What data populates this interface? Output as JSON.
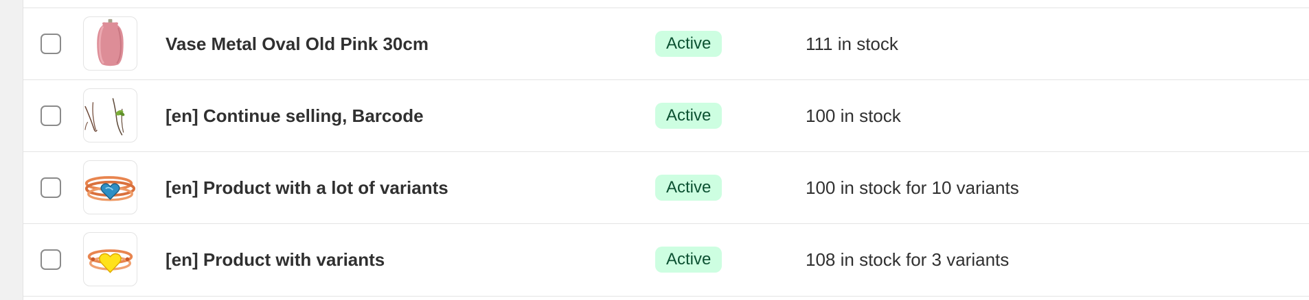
{
  "products": [
    {
      "title": "Vase Metal Oval Old Pink 30cm",
      "status": "Active",
      "inventory": "111 in stock",
      "thumbnail_icon": "pink-vase-image"
    },
    {
      "title": "[en] Continue selling, Barcode",
      "status": "Active",
      "inventory": "100 in stock",
      "thumbnail_icon": "branches-image"
    },
    {
      "title": "[en] Product with a lot of variants",
      "status": "Active",
      "inventory": "100 in stock for 10 variants",
      "thumbnail_icon": "blue-heart-ring-image"
    },
    {
      "title": "[en] Product with variants",
      "status": "Active",
      "inventory": "108 in stock for 3 variants",
      "thumbnail_icon": "yellow-heart-ring-image"
    }
  ],
  "colors": {
    "badge_bg": "#cdfee1",
    "badge_text": "#0c5132",
    "divider": "#e3e3e3"
  }
}
